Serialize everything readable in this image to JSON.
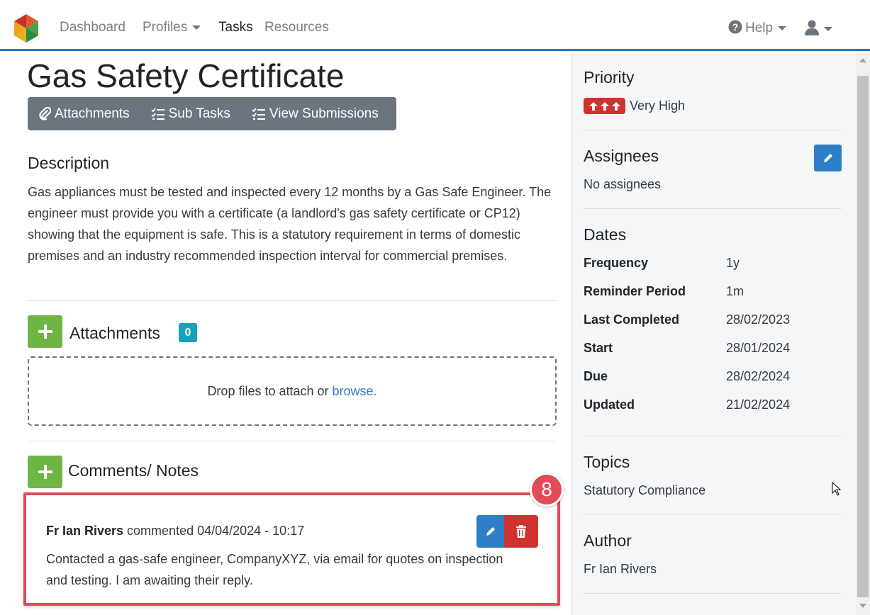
{
  "nav": {
    "items": [
      {
        "label": "Dashboard"
      },
      {
        "label": "Profiles"
      },
      {
        "label": "Tasks"
      },
      {
        "label": "Resources"
      }
    ],
    "help_label": "Help"
  },
  "page": {
    "title": "Gas Safety Certificate",
    "toolbar": {
      "attachments_label": "Attachments",
      "subtasks_label": "Sub Tasks",
      "submissions_label": "View Submissions"
    }
  },
  "description": {
    "title": "Description",
    "text": "Gas appliances must be tested and inspected every 12 months by a Gas Safe Engineer. The engineer must provide you with a certificate (a landlord's gas safety certificate or CP12) showing that the equipment is safe. This is a statutory requirement in terms of domestic premises and an industry recommended inspection interval for commercial premises."
  },
  "attachments": {
    "title": "Attachments",
    "count": "0",
    "dropzone_text": "Drop files to attach or ",
    "browse_label": "browse."
  },
  "comments": {
    "title": "Comments/ Notes",
    "items": [
      {
        "author": "Fr Ian Rivers",
        "meta": " commented 04/04/2024 - 10:17",
        "text": "Contacted a gas-safe engineer, CompanyXYZ, via email for quotes on inspection and testing. I am awaiting their reply."
      }
    ],
    "step_number": "8"
  },
  "sidebar": {
    "priority": {
      "title": "Priority",
      "value": "Very High",
      "color": "#d2322d"
    },
    "assignees": {
      "title": "Assignees",
      "value": "No assignees"
    },
    "dates": {
      "title": "Dates",
      "rows": [
        {
          "label": "Frequency",
          "value": "1y"
        },
        {
          "label": "Reminder Period",
          "value": "1m"
        },
        {
          "label": "Last Completed",
          "value": "28/02/2023"
        },
        {
          "label": "Start",
          "value": "28/01/2024"
        },
        {
          "label": "Due",
          "value": "28/02/2024"
        },
        {
          "label": "Updated",
          "value": "21/02/2024"
        }
      ]
    },
    "topics": {
      "title": "Topics",
      "value": "Statutory Compliance"
    },
    "author": {
      "title": "Author",
      "value": "Fr Ian Rivers"
    }
  },
  "colors": {
    "accent": "#2b7bc0",
    "success": "#6fb543",
    "danger": "#d2322d",
    "info": "#17a2b8",
    "secondary": "#6c757d"
  }
}
